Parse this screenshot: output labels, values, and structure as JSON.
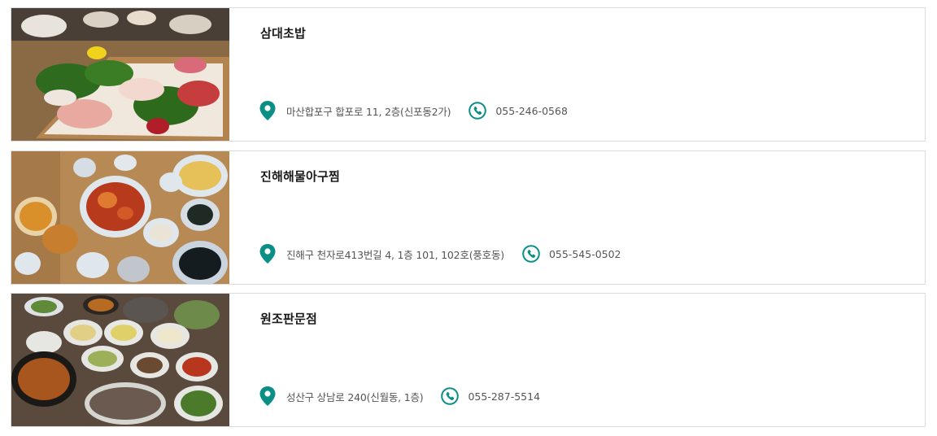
{
  "theme": {
    "accent": "#0a8f87",
    "border": "#dcdcdc",
    "text": "#1a1a1a",
    "muted": "#555555"
  },
  "restaurants": [
    {
      "name": "삼대초밥",
      "address": "마산합포구 합포로 11, 2층(신포동2가)",
      "phone": "055-246-0568",
      "photo": "sashimi-platter"
    },
    {
      "name": "진해해물아구찜",
      "address": "진해구 천자로413번길 4, 1층 101, 102호(풍호동)",
      "phone": "055-545-0502",
      "photo": "braised-monkfish-table"
    },
    {
      "name": "원조판문점",
      "address": "성산구 상남로 240(신월동, 1층)",
      "phone": "055-287-5514",
      "photo": "korean-side-dishes-table"
    }
  ]
}
